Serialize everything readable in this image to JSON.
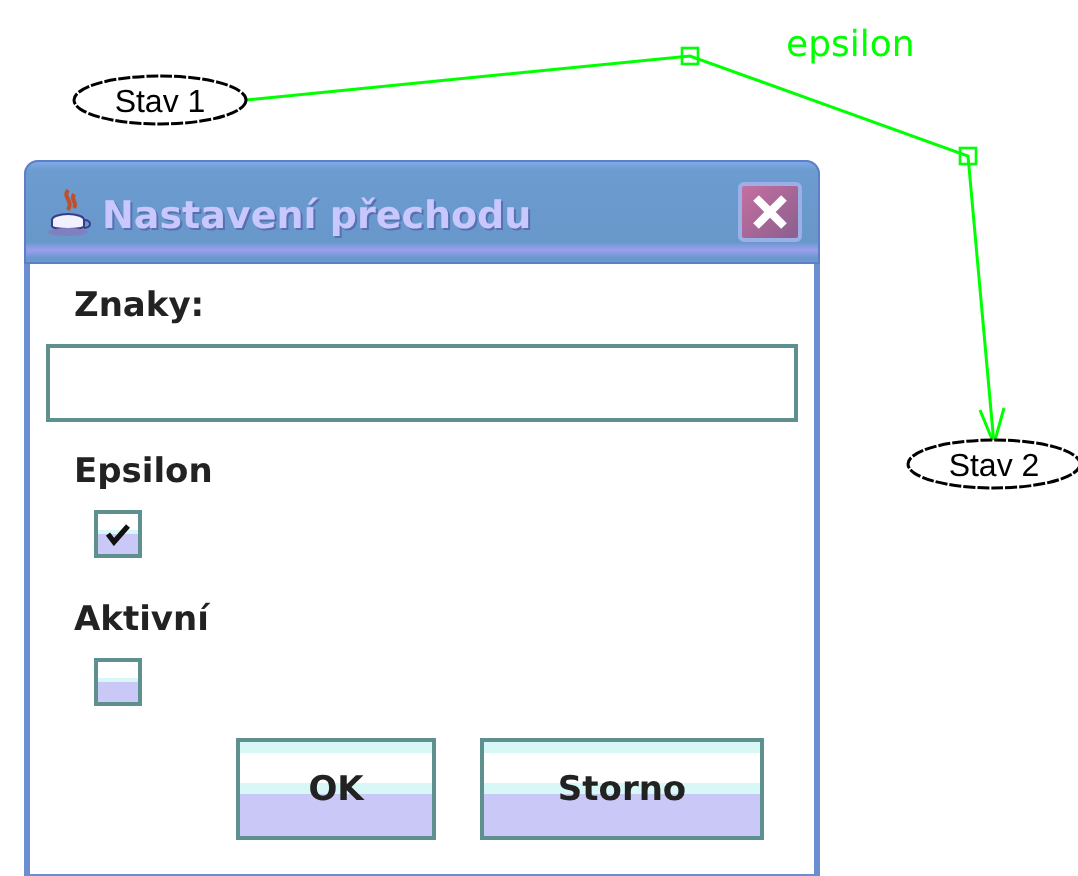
{
  "canvas": {
    "states": [
      {
        "label": "Stav 1"
      },
      {
        "label": "Stav 2"
      }
    ],
    "transitions": [
      {
        "label": "epsilon"
      }
    ]
  },
  "dialog": {
    "title": "Nastavení přechodu",
    "controls": [
      {
        "kind": "text",
        "label": "Znaky:"
      },
      {
        "kind": "checkbox",
        "label": "Epsilon",
        "checked": true
      },
      {
        "kind": "checkbox",
        "label": "Aktivní",
        "checked": false
      }
    ],
    "buttons": [
      "OK",
      "Storno"
    ]
  }
}
